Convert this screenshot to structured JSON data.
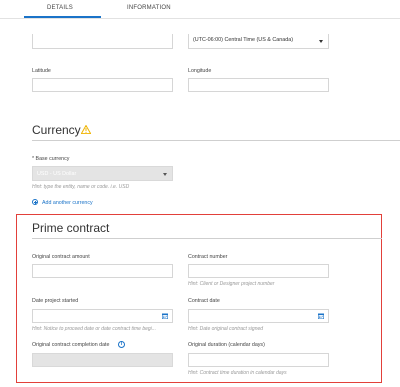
{
  "tabs": [
    {
      "label": "DETAILS",
      "active": true
    },
    {
      "label": "INFORMATION",
      "active": false
    }
  ],
  "location": {
    "timezone_value": "(UTC-06:00) Central Time (US & Canada)",
    "latitude_label": "Latitude",
    "latitude_value": "",
    "longitude_label": "Longitude",
    "longitude_value": ""
  },
  "currency": {
    "title": "Currency",
    "warning_icon": "warning-icon",
    "base_currency_label": "* Base currency",
    "base_currency_value": "USD - US Dollar",
    "base_currency_hint": "Hint: type the entity, name or code. i.e. USD",
    "add_currency_label": "Add another currency"
  },
  "prime_contract": {
    "title": "Prime contract",
    "original_amount_label": "Original contract amount",
    "original_amount_value": "",
    "contract_number_label": "Contract number",
    "contract_number_value": "",
    "contract_number_hint": "Hint: Client or Designer project number",
    "date_started_label": "Date project started",
    "date_started_value": "",
    "date_started_hint": "Hint: Notice to proceed date or date contract time begi...",
    "contract_date_label": "Contract date",
    "contract_date_value": "",
    "contract_date_hint": "Hint: Date original contract signed",
    "completion_date_label": "Original contract completion date",
    "completion_date_value": "",
    "original_duration_label": "Original duration (calendar days)",
    "original_duration_value": "",
    "original_duration_hint": "Hint: Contract time duration in calendar days"
  },
  "colors": {
    "accent": "#1a73c8",
    "highlight": "#e2403a",
    "warning": "#f0b400",
    "disabled_field": "#e4e4e4"
  }
}
